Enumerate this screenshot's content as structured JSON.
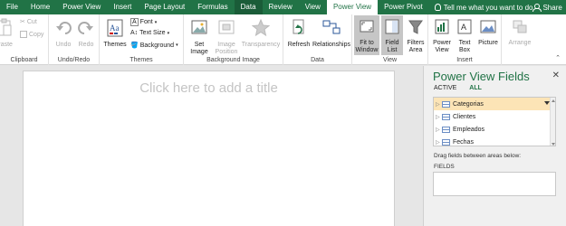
{
  "tabs": [
    "File",
    "Home",
    "Power View",
    "Insert",
    "Page Layout",
    "Formulas",
    "Data",
    "Review",
    "View",
    "Power View",
    "Power Pivot"
  ],
  "active_tab_index": 9,
  "tell_me": "Tell me what you want to do",
  "share": "Share",
  "colors": {
    "accent": "#217346",
    "tabbar": "#217346",
    "selected_button": "#c6c6c6",
    "highlight_row": "#fce4b6"
  },
  "ribbon": {
    "clipboard": {
      "paste": "Paste",
      "cut": "Cut",
      "copy": "Copy",
      "label": "Clipboard"
    },
    "undo_redo": {
      "undo": "Undo",
      "redo": "Redo",
      "label": "Undo/Redo"
    },
    "themes": {
      "themes": "Themes",
      "font": "Font",
      "text_size": "Text Size",
      "background": "Background",
      "label": "Themes"
    },
    "background_image": {
      "set_image_1": "Set",
      "set_image_2": "Image",
      "image_position_1": "Image",
      "image_position_2": "Position",
      "transparency": "Transparency",
      "label": "Background Image"
    },
    "data": {
      "refresh": "Refresh",
      "relationships": "Relationships",
      "label": "Data"
    },
    "view": {
      "fit_1": "Fit to",
      "fit_2": "Window",
      "field_1": "Field",
      "field_2": "List",
      "filters_1": "Filters",
      "filters_2": "Area",
      "label": "View"
    },
    "insert": {
      "pv_1": "Power",
      "pv_2": "View",
      "tb_1": "Text",
      "tb_2": "Box",
      "picture": "Picture",
      "label": "Insert"
    },
    "arrange": {
      "arrange": "Arrange",
      "label": "Arrange"
    }
  },
  "canvas": {
    "title_placeholder": "Click here to add a title"
  },
  "fields_pane": {
    "title": "Power View Fields",
    "tab_active": "ACTIVE",
    "tab_all": "ALL",
    "tables": [
      "Categorias",
      "Clientes",
      "Empleados",
      "Fechas"
    ],
    "drag_label": "Drag fields between areas below:",
    "fields_label": "FIELDS"
  }
}
